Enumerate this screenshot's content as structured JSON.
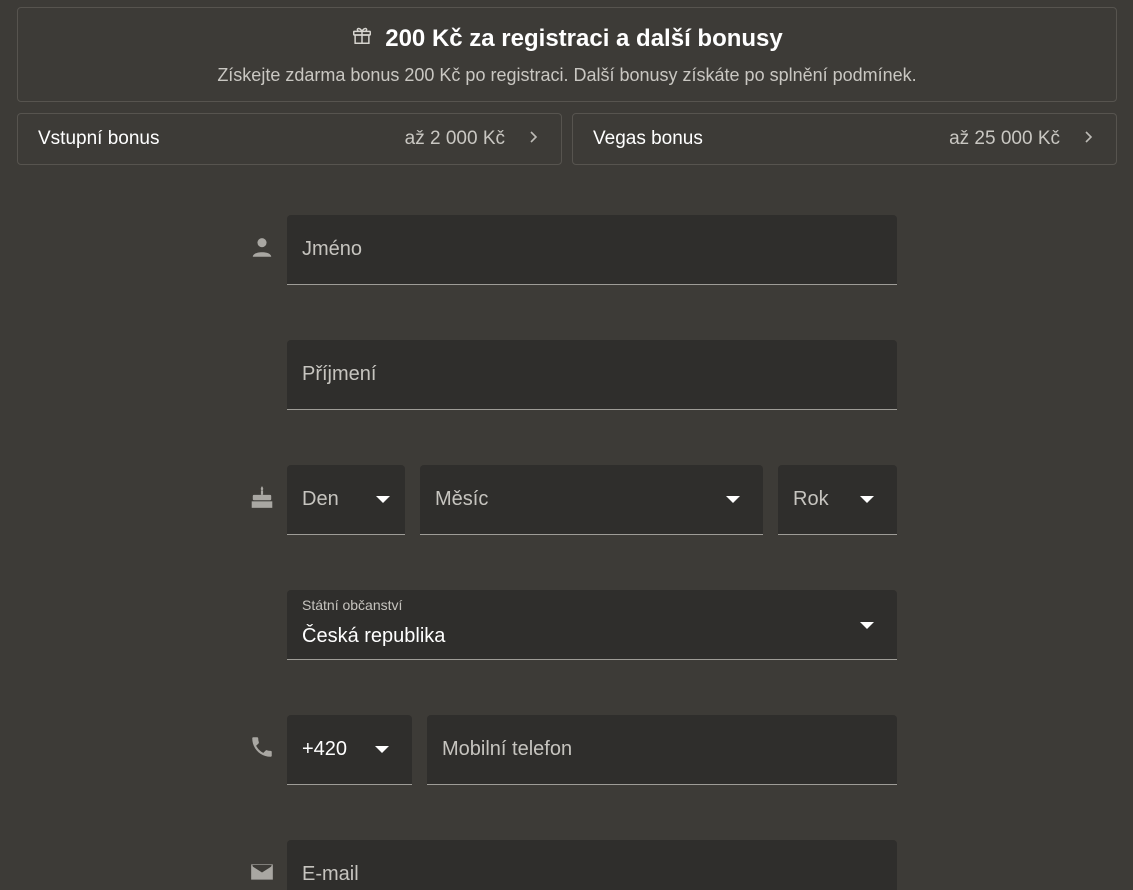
{
  "promo": {
    "title": "200 Kč za registraci a další bonusy",
    "subtitle": "Získejte zdarma bonus 200 Kč po registraci. Další bonusy získáte po splnění podmínek."
  },
  "bonuses": [
    {
      "name": "Vstupní bonus",
      "amount": "až 2 000 Kč"
    },
    {
      "name": "Vegas bonus",
      "amount": "až 25 000 Kč"
    }
  ],
  "form": {
    "first_name_placeholder": "Jméno",
    "last_name_placeholder": "Příjmení",
    "day_placeholder": "Den",
    "month_placeholder": "Měsíc",
    "year_placeholder": "Rok",
    "citizenship_label": "Státní občanství",
    "citizenship_value": "Česká republika",
    "phone_prefix": "+420",
    "phone_placeholder": "Mobilní telefon",
    "email_placeholder": "E-mail"
  },
  "icons": {
    "gift": "gift-icon",
    "person": "person-icon",
    "cake": "cake-icon",
    "phone": "phone-icon",
    "mail": "mail-icon",
    "chevron": "chevron-right-icon",
    "dropdown": "dropdown-arrow-icon"
  }
}
